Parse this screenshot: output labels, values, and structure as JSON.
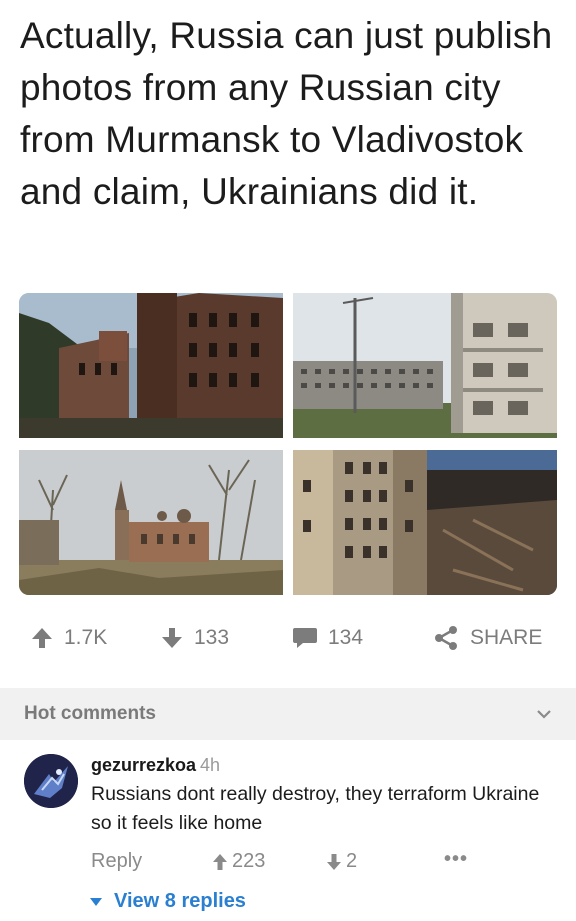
{
  "post": {
    "text": "Actually, Russia can just publish photos from any Russian city from Murmansk to Vladivostok and claim, Ukrainians did it."
  },
  "images": [
    {
      "name": "ruined-brick-buildings-photo"
    },
    {
      "name": "abandoned-apartment-blocks-photo"
    },
    {
      "name": "ruined-church-village-photo"
    },
    {
      "name": "collapsed-courtyard-buildings-photo"
    }
  ],
  "actions": {
    "upvotes": "1.7K",
    "downvotes": "133",
    "comments": "134",
    "share": "SHARE"
  },
  "hot_comments": {
    "header": "Hot comments"
  },
  "comment": {
    "username": "gezurrezkoa",
    "time": "4h",
    "text": "Russians dont really destroy, they terraform Ukraine so it feels like home",
    "reply_label": "Reply",
    "upvotes": "223",
    "downvotes": "2",
    "more": "•••",
    "view_replies": "View 8 replies"
  },
  "colors": {
    "accent": "#2a7fd1",
    "icon_gray": "#7c7c7c",
    "header_bg": "#f1f1f1"
  }
}
